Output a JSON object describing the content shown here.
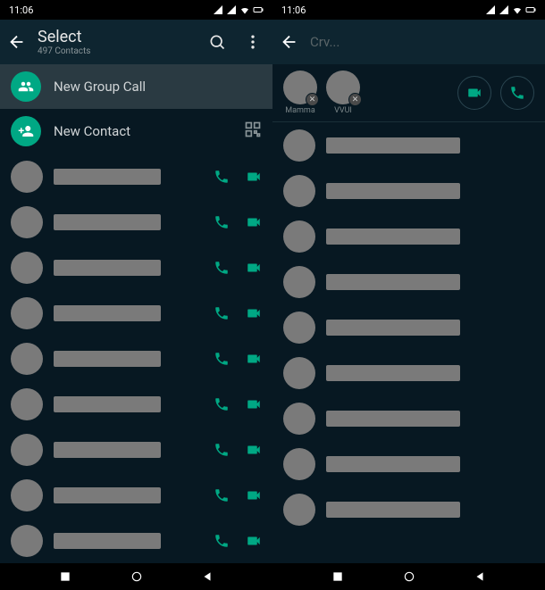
{
  "status": {
    "time": "11:06"
  },
  "left": {
    "title": "Select",
    "subtitle": "497 Contacts",
    "new_group_call": "New Group Call",
    "new_contact": "New Contact",
    "contact_count": 9
  },
  "right": {
    "title": "Crv...",
    "selected": [
      {
        "name": "Mamma"
      },
      {
        "name": "VVUI"
      }
    ],
    "contact_count": 9
  },
  "colors": {
    "accent": "#00a884",
    "bg": "#071822"
  }
}
